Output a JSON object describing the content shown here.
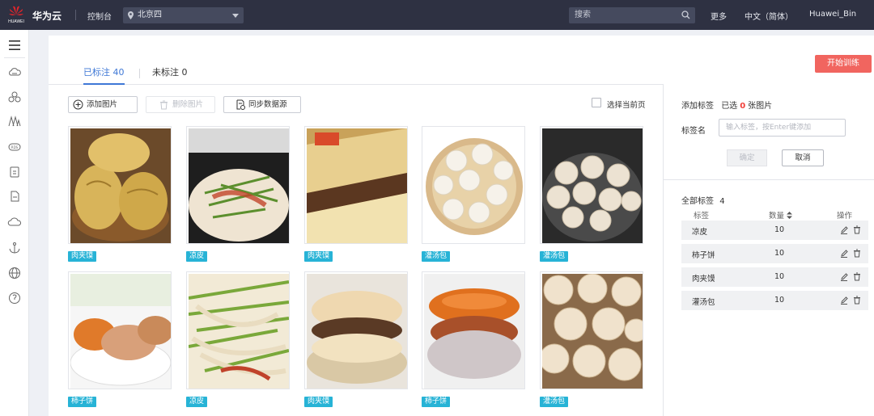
{
  "topbar": {
    "logo_text": "HUAWEI",
    "brand": "华为云",
    "console": "控制台",
    "region": "北京四",
    "search_placeholder": "搜索",
    "more": "更多",
    "language": "中文（简体）",
    "user": "Huawei_Bin"
  },
  "sidebar": {
    "icons": [
      "menu-icon",
      "cloud-server-icon",
      "cluster-icon",
      "container-icon",
      "network-icon",
      "storage-icon",
      "doc-icon",
      "cloud-icon",
      "anchor-icon",
      "globe-icon",
      "bulb-icon"
    ]
  },
  "main": {
    "start_training": "开始训练",
    "tabs": [
      {
        "label": "已标注 40",
        "active": true
      },
      {
        "label": "未标注 0",
        "active": false
      }
    ],
    "toolbar": {
      "add_image": "添加图片",
      "delete_image": "删除图片",
      "sync_source": "同步数据源",
      "select_page": "选择当前页"
    },
    "images": [
      {
        "tag": "肉夹馍",
        "subject": "rou-jia-mo"
      },
      {
        "tag": "凉皮",
        "subject": "liang-pi"
      },
      {
        "tag": "肉夹馍",
        "subject": "rou-jia-mo"
      },
      {
        "tag": "灌汤包",
        "subject": "guan-tang-bao"
      },
      {
        "tag": "灌汤包",
        "subject": "guan-tang-bao"
      },
      {
        "tag": "柿子饼",
        "subject": "shi-zi-bing"
      },
      {
        "tag": "凉皮",
        "subject": "liang-pi"
      },
      {
        "tag": "肉夹馍",
        "subject": "rou-jia-mo"
      },
      {
        "tag": "柿子饼",
        "subject": "shi-zi-bing"
      },
      {
        "tag": "灌汤包",
        "subject": "guan-tang-bao"
      }
    ]
  },
  "right_panel": {
    "add_label_title": "添加标签",
    "selected_prefix": "已选",
    "selected_count": "0",
    "selected_suffix": "张图片",
    "label_name": "标签名",
    "label_placeholder": "输入标签，按Enter键添加",
    "confirm": "确定",
    "cancel": "取消",
    "all_labels_title": "全部标签",
    "all_labels_count": "4",
    "table_headers": {
      "label": "标签",
      "count": "数量",
      "action": "操作"
    },
    "labels": [
      {
        "name": "凉皮",
        "count": "10"
      },
      {
        "name": "柿子饼",
        "count": "10"
      },
      {
        "name": "肉夹馍",
        "count": "10"
      },
      {
        "name": "灌汤包",
        "count": "10"
      }
    ]
  },
  "colors": {
    "topbar": "#2e3142",
    "accent_blue": "#3f78d6",
    "start_button": "#f1655f",
    "tag": "#27b3d6"
  }
}
